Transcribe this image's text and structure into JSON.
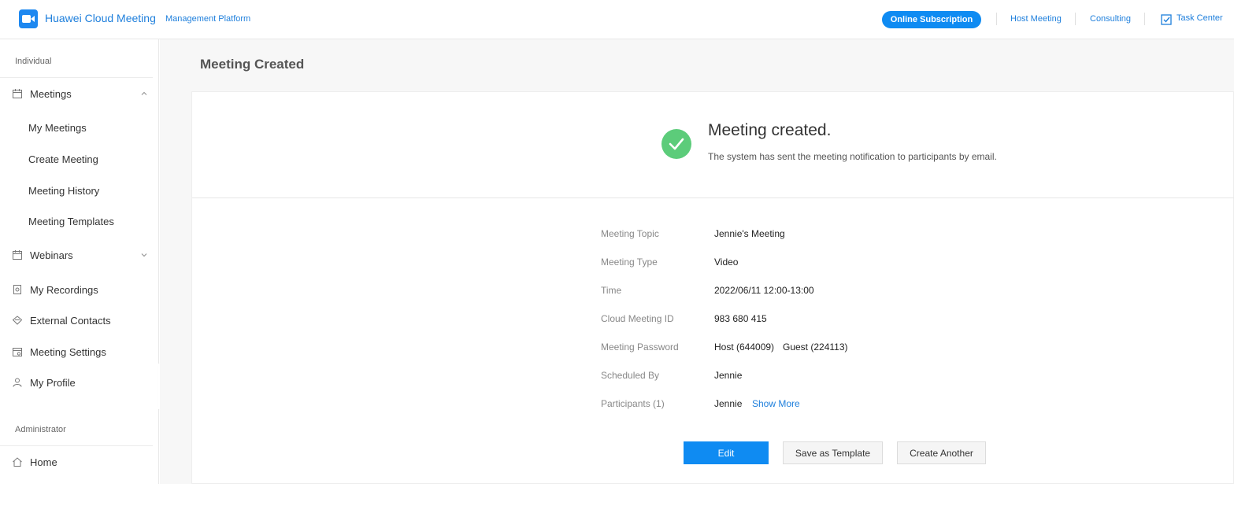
{
  "header": {
    "app_name": "Huawei Cloud Meeting",
    "app_sub": "Management Platform",
    "subscription_label": "Online Subscription",
    "host_meeting": "Host Meeting",
    "consulting": "Consulting",
    "task_center": "Task Center",
    "logo_icon": "video-camera-icon",
    "accent_color": "#0f8bf2"
  },
  "sidebar": {
    "individual_label": "Individual",
    "administrator_label": "Administrator",
    "meetings": {
      "label": "Meetings",
      "icon": "calendar-icon",
      "sub_items": [
        "My Meetings",
        "Create Meeting",
        "Meeting History",
        "Meeting Templates"
      ]
    },
    "webinars": {
      "label": "Webinars",
      "icon": "calendar-icon"
    },
    "recordings": {
      "label": "My Recordings",
      "icon": "recording-icon"
    },
    "contacts": {
      "label": "External Contacts",
      "icon": "contacts-icon"
    },
    "settings": {
      "label": "Meeting Settings",
      "icon": "calendar-settings-icon"
    },
    "profile": {
      "label": "My Profile",
      "icon": "user-icon"
    },
    "home": {
      "label": "Home",
      "icon": "home-icon"
    }
  },
  "main": {
    "page_title": "Meeting Created",
    "success_title": "Meeting created.",
    "success_desc": "The system has sent the meeting notification to participants by email.",
    "success_color": "#5ccc7a",
    "details": {
      "topic_label": "Meeting Topic",
      "topic_value": "Jennie's Meeting",
      "type_label": "Meeting Type",
      "type_value": "Video",
      "time_label": "Time",
      "time_value": "2022/06/11 12:00-13:00",
      "id_label": "Cloud Meeting ID",
      "id_value": "983 680 415",
      "password_label": "Meeting Password",
      "password_host": "Host (644009)",
      "password_guest": "Guest (224113)",
      "scheduled_label": "Scheduled By",
      "scheduled_value": "Jennie",
      "participants_label": "Participants (1)",
      "participants_value": "Jennie",
      "show_more": "Show More"
    },
    "buttons": {
      "edit": "Edit",
      "save_template": "Save as Template",
      "create_another": "Create Another"
    }
  }
}
